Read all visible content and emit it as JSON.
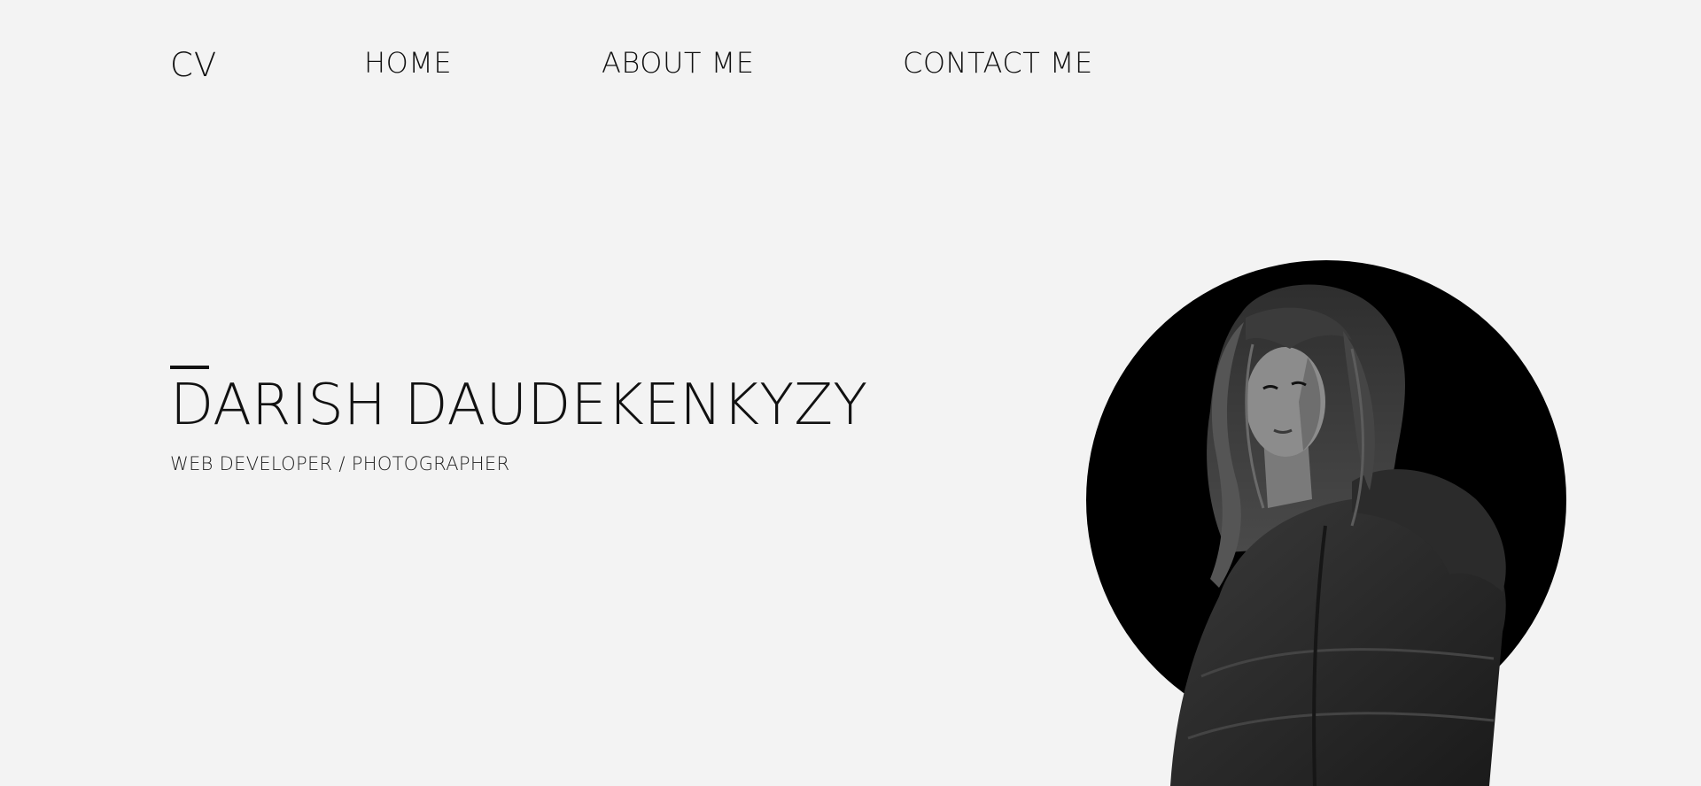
{
  "header": {
    "logo": "CV",
    "nav": [
      {
        "label": "HOME"
      },
      {
        "label": "ABOUT ME"
      },
      {
        "label": "CONTACT ME"
      }
    ]
  },
  "hero": {
    "name": "DARISH DAUDEKENKYZY",
    "role": "WEB DEVELOPER / PHOTOGRAPHER"
  },
  "colors": {
    "background": "#f3f3f3",
    "text": "#111111",
    "circle": "#000000"
  }
}
